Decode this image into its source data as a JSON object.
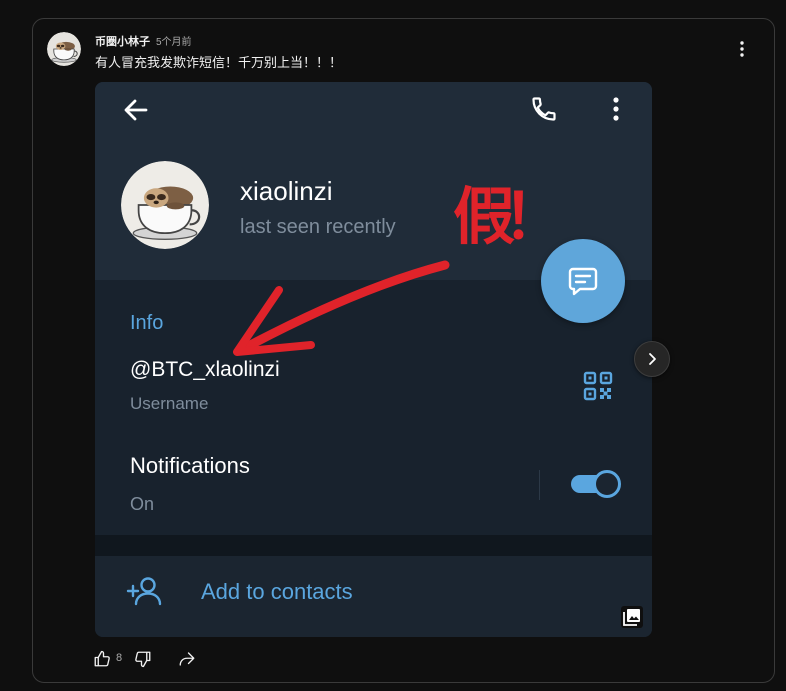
{
  "post": {
    "channel_name": "币圈小林子",
    "time_ago": "5个月前",
    "text": "有人冒充我发欺诈短信！千万别上当！！！",
    "like_count": "8"
  },
  "telegram_screenshot": {
    "contact_name": "xiaolinzi",
    "last_seen": "last seen recently",
    "info_heading": "Info",
    "username": "@BTC_xlaolinzi",
    "username_caption": "Username",
    "notifications_label": "Notifications",
    "notifications_status": "On",
    "notifications_enabled": true,
    "add_contact_label": "Add to contacts"
  },
  "annotation": {
    "text": "假！",
    "color": "#e0232a"
  },
  "colors": {
    "page_background": "#0f0f0f",
    "telegram_accent": "#5aa6df",
    "telegram_fab": "#5fa6da",
    "telegram_header": "#202c39",
    "telegram_body": "#18222d",
    "annotation_red": "#e0232a"
  },
  "icons": {
    "post_menu": "more-vert-icon",
    "back": "back-arrow-icon",
    "call": "phone-icon",
    "profile_menu": "more-vert-icon",
    "fab": "message-icon",
    "qr": "qr-code-icon",
    "add_contact": "add-contact-icon",
    "multi_image": "gallery-icon",
    "next": "chevron-right-icon",
    "like": "thumb-up-icon",
    "dislike": "thumb-down-icon",
    "share": "share-icon"
  }
}
